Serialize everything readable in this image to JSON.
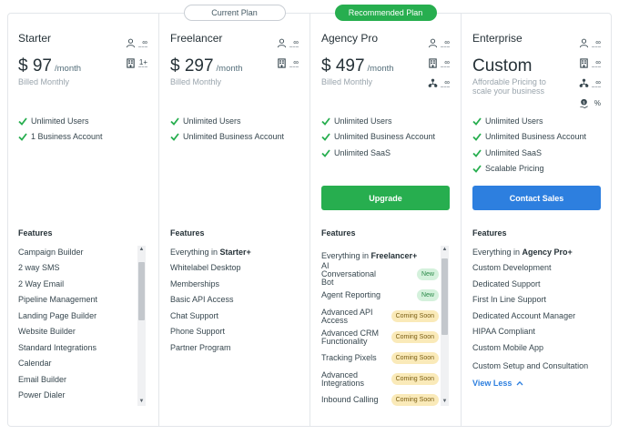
{
  "plans": {
    "starter": {
      "title": "Starter",
      "price": "$ 97",
      "period": "/month",
      "billed": "Billed Monthly",
      "meta": [
        "∞",
        "1+"
      ],
      "bullets": [
        "Unlimited Users",
        "1 Business Account"
      ],
      "features": [
        "Campaign Builder",
        "2 way SMS",
        "2 Way Email",
        "Pipeline Management",
        "Landing Page Builder",
        "Website Builder",
        "Standard Integrations",
        "Calendar",
        "Email Builder",
        "Power Dialer"
      ]
    },
    "freelancer": {
      "tag": "Current Plan",
      "title": "Freelancer",
      "price": "$ 297",
      "period": "/month",
      "billed": "Billed Monthly",
      "meta": [
        "∞",
        "∞"
      ],
      "bullets": [
        "Unlimited Users",
        "Unlimited Business Account"
      ],
      "features_first_prefix": "Everything in ",
      "features_first_bold": "Starter+",
      "features": [
        "Whitelabel Desktop",
        "Memberships",
        "Basic API Access",
        "Chat Support",
        "Phone Support",
        "Partner Program"
      ]
    },
    "agency": {
      "tag": "Recommended Plan",
      "title": "Agency Pro",
      "price": "$ 497",
      "period": "/month",
      "billed": "Billed Monthly",
      "meta": [
        "∞",
        "∞",
        "∞"
      ],
      "bullets": [
        "Unlimited Users",
        "Unlimited Business Account",
        "Unlimited SaaS"
      ],
      "cta": "Upgrade",
      "features_first_prefix": "Everything in ",
      "features_first_bold": "Freelancer+",
      "features": [
        {
          "label": "AI Conversational Bot",
          "badge": "New"
        },
        {
          "label": "Agent Reporting",
          "badge": "New"
        },
        {
          "label": "Advanced API Access",
          "badge": "Coming Soon"
        },
        {
          "label": "Advanced CRM Functionality",
          "badge": "Coming Soon"
        },
        {
          "label": "Tracking Pixels",
          "badge": "Coming Soon"
        },
        {
          "label": "Advanced Integrations",
          "badge": "Coming Soon"
        },
        {
          "label": "Inbound Calling",
          "badge": "Coming Soon"
        }
      ]
    },
    "enterprise": {
      "title": "Enterprise",
      "price": "Custom",
      "billed": "Affordable Pricing to scale your business",
      "meta": [
        "∞",
        "∞",
        "∞",
        "%"
      ],
      "bullets": [
        "Unlimited Users",
        "Unlimited Business Account",
        "Unlimited SaaS",
        "Scalable Pricing"
      ],
      "cta": "Contact Sales",
      "features_first_prefix": "Everything in ",
      "features_first_bold": "Agency Pro+",
      "features": [
        "Custom Development",
        "Dedicated Support",
        "First In Line Support",
        "Dedicated Account Manager",
        "HIPAA Compliant",
        "Custom Mobile App",
        "Custom Setup and Consultation"
      ],
      "view_less": "View Less"
    }
  },
  "features_heading": "Features",
  "colors": {
    "green": "#27ae4f",
    "blue": "#2d7fdf",
    "border": "#e3e6ea"
  },
  "icons": [
    "user-icon",
    "building-icon",
    "network-icon",
    "dollar-hand-icon",
    "check-icon",
    "chevron-up-icon"
  ]
}
